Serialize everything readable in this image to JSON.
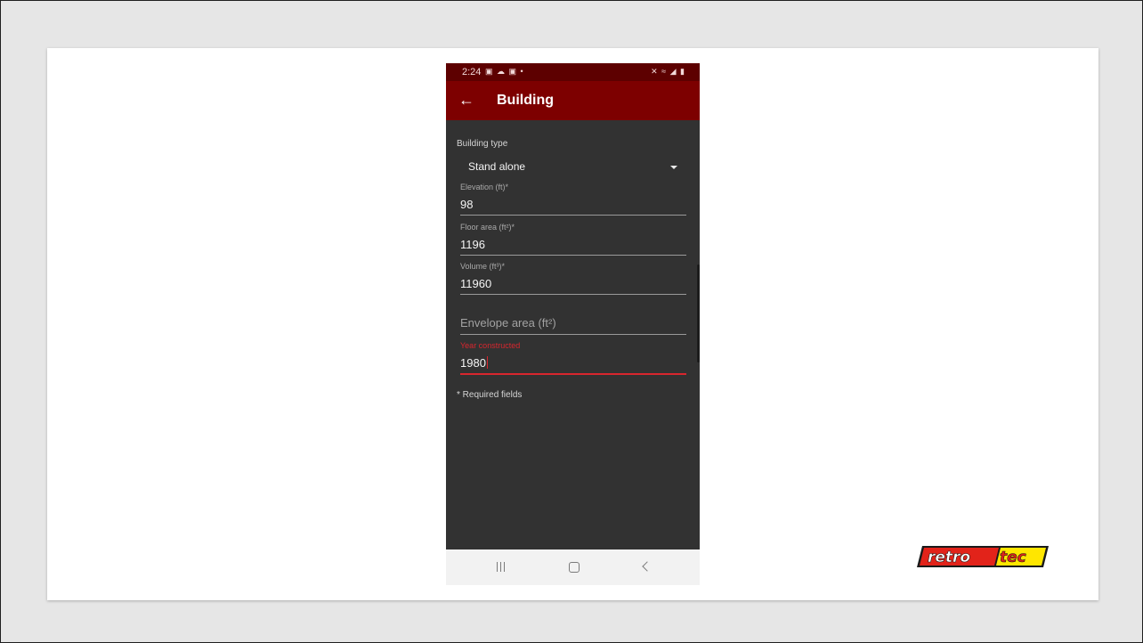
{
  "status_bar": {
    "time": "2:24",
    "left_icons": "▣ ☁ ▣ •",
    "right_icons": "✕ ≈ ◢ ▮"
  },
  "app_bar": {
    "title": "Building"
  },
  "form": {
    "building_type": {
      "label": "Building type",
      "value": "Stand alone"
    },
    "elevation": {
      "label": "Elevation (ft)*",
      "value": "98"
    },
    "floor_area": {
      "label": "Floor area (ft²)*",
      "value": "1196"
    },
    "volume": {
      "label": "Volume (ft³)*",
      "value": "11960"
    },
    "envelope_area": {
      "placeholder": "Envelope area (ft²)"
    },
    "year_constructed": {
      "label": "Year constructed",
      "value": "1980"
    },
    "required_note": "* Required fields"
  },
  "logo": {
    "text_left": "retro",
    "text_right": "tec",
    "colors": {
      "red": "#e2231a",
      "yellow": "#ffe600",
      "outline": "#1a1a1a"
    }
  },
  "colors": {
    "status_bar": "#5d0000",
    "app_bar": "#7d0000",
    "form_bg": "#323232",
    "accent_error": "#d8262e"
  }
}
